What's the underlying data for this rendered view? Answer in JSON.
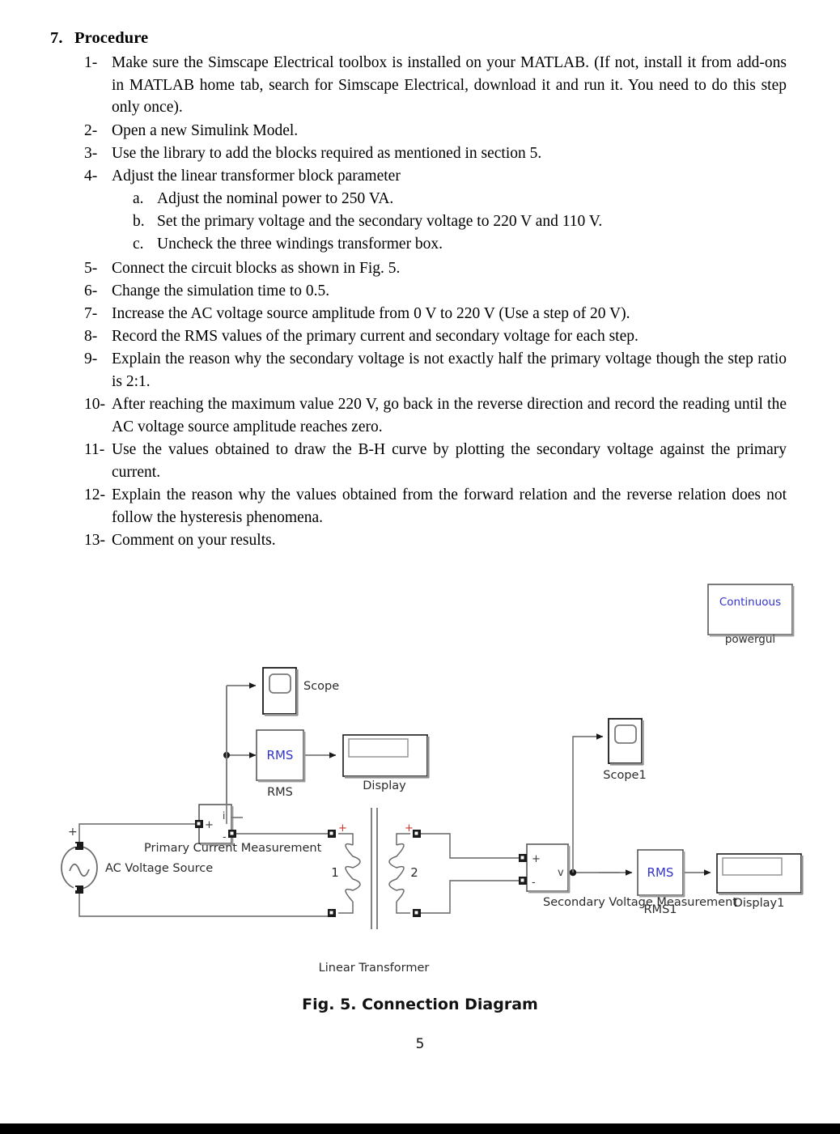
{
  "section": {
    "number": "7.",
    "title": "Procedure"
  },
  "steps": [
    {
      "marker": "1-",
      "text": "Make sure the Simscape Electrical toolbox is installed on your MATLAB. (If not, install it from add-ons in MATLAB home tab, search for Simscape Electrical, download it and run it. You need to do this step only once)."
    },
    {
      "marker": "2-",
      "text": "Open a new Simulink Model."
    },
    {
      "marker": "3-",
      "text": "Use the library to add the blocks required as mentioned in section 5."
    },
    {
      "marker": "4-",
      "text": "Adjust the linear transformer block parameter"
    },
    {
      "marker": "5-",
      "text": "Connect the circuit blocks as shown in Fig. 5."
    },
    {
      "marker": "6-",
      "text": "Change the simulation time to 0.5."
    },
    {
      "marker": "7-",
      "text": "Increase the AC voltage source amplitude from 0 V to 220 V (Use a step of 20 V)."
    },
    {
      "marker": "8-",
      "text": "Record the RMS values of the primary current and secondary voltage for each step."
    },
    {
      "marker": "9-",
      "text": "Explain the reason why the secondary voltage is not exactly half the primary voltage though the step ratio is 2:1."
    },
    {
      "marker": "10-",
      "text": "After reaching the maximum value 220 V, go back in the reverse direction and record the reading until the AC voltage source amplitude reaches zero."
    },
    {
      "marker": "11-",
      "text": "Use the values obtained to draw the B-H curve by plotting the secondary voltage against the primary current."
    },
    {
      "marker": "12-",
      "text": "Explain the reason why the values obtained from the forward relation and the reverse relation does not follow the hysteresis phenomena."
    },
    {
      "marker": "13-",
      "text": "Comment on your results."
    }
  ],
  "substeps": [
    {
      "marker": "a.",
      "text": "Adjust the nominal power to 250 VA."
    },
    {
      "marker": "b.",
      "text": "Set the primary voltage and the secondary voltage to 220 V and 110 V."
    },
    {
      "marker": "c.",
      "text": "Uncheck the three windings transformer box."
    }
  ],
  "figure": {
    "caption": "Fig. 5. Connection Diagram",
    "page_number": "5",
    "blocks": {
      "powergui_value": "Continuous",
      "powergui_label": "powergui",
      "scope_label": "Scope",
      "scope1_label": "Scope1",
      "rms_value": "RMS",
      "rms_label": "RMS",
      "rms1_label": "RMS1",
      "display_label": "Display",
      "display1_label": "Display1",
      "ac_source_label": "AC Voltage Source",
      "primary_current_label": "Primary Current Measurement",
      "secondary_voltage_label": "Secondary Voltage Measurement",
      "transformer_label": "Linear Transformer",
      "winding1_label": "1",
      "winding2_label": "2",
      "plus_sign": "+",
      "minus_sign": "-",
      "current_port": "i",
      "voltage_port": "v"
    },
    "colors": {
      "block_text_blue": "#3333cc",
      "block_border": "#5a5a5a",
      "wire": "#7a7a7a",
      "port_marker": "#1a1a1a",
      "plus_marker_red": "#d0322d",
      "label_text": "#2b2b2b"
    }
  }
}
